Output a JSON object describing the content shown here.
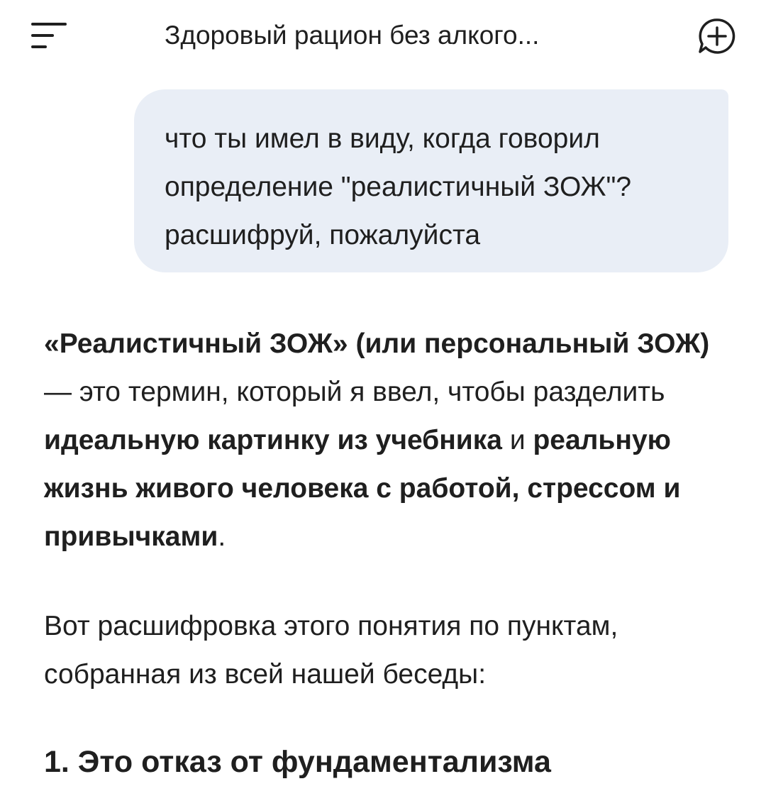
{
  "header": {
    "title": "Здоровый рацион без алкого...",
    "menu_icon": "menu-icon",
    "new_chat_icon": "new-chat-icon"
  },
  "user_message": {
    "line1": "что ты имел в виду, когда говорил",
    "line2": "определение \"реалистичный ЗОЖ\"?",
    "line3": "расшифруй, пожалуйста"
  },
  "response": {
    "p1": {
      "b1": "«Реалистичный ЗОЖ» (или персональный ЗОЖ)",
      "t1": " — это термин, который я ввел, чтобы разделить ",
      "b2": "идеальную картинку из учебника",
      "t2": " и ",
      "b3": "реальную жизнь живого человека с работой, стрессом и привычками",
      "t3": "."
    },
    "p2": "Вот расшифровка этого понятия по пунктам, собранная из всей нашей беседы:",
    "heading1": "1. Это отказ от фундаментализма"
  },
  "colors": {
    "bubble_bg": "#e9eef6",
    "text": "#1f1f1f"
  }
}
